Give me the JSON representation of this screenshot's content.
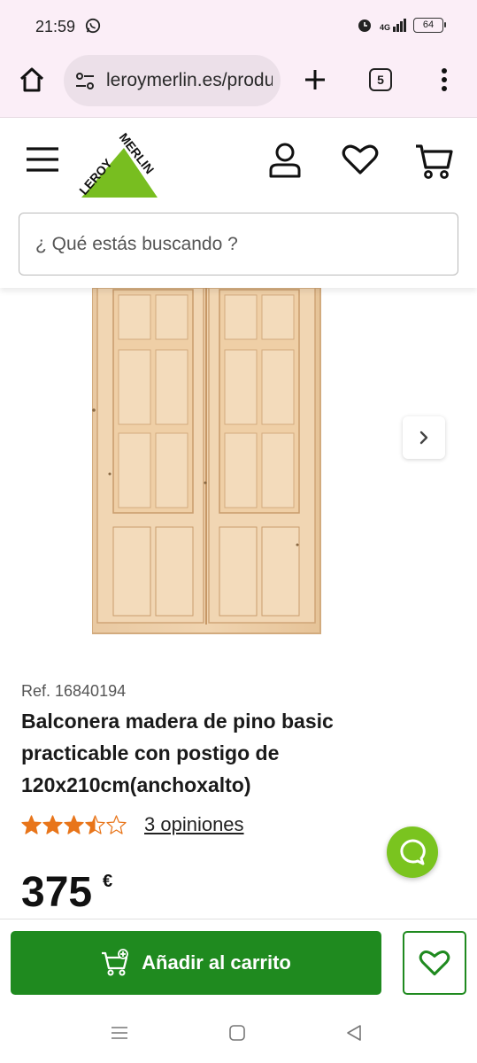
{
  "status_bar": {
    "time": "21:59",
    "network": "4G",
    "battery": "64"
  },
  "browser": {
    "url": "leroymerlin.es/producto",
    "tab_count": "5"
  },
  "site": {
    "logo_text_1": "LEROY",
    "logo_text_2": "MERLIN",
    "search_placeholder": "¿ Qué estás buscando ?"
  },
  "product": {
    "ref": "Ref. 16840194",
    "title": "Balconera madera de pino basic practicable con postigo de 120x210cm(anchoxalto)",
    "rating": 3.5,
    "rating_max": 5,
    "reviews_label": "3 opiniones",
    "price": "375",
    "currency": "€"
  },
  "actions": {
    "add_to_cart": "Añadir al carrito"
  },
  "colors": {
    "brand_green": "#1f8a1f",
    "logo_green": "#78be20",
    "star_orange": "#e8751a",
    "chat_green": "#7ac41f"
  },
  "icons": [
    "whatsapp-icon",
    "alarm-icon",
    "signal-icon",
    "battery-icon",
    "home-icon",
    "tune-icon",
    "plus-icon",
    "tabs-icon",
    "more-icon",
    "menu-icon",
    "user-icon",
    "heart-icon",
    "cart-icon",
    "chevron-right-icon",
    "star-icon",
    "chat-icon",
    "cart-plus-icon",
    "recent-apps-icon",
    "home-nav-icon",
    "back-icon"
  ]
}
